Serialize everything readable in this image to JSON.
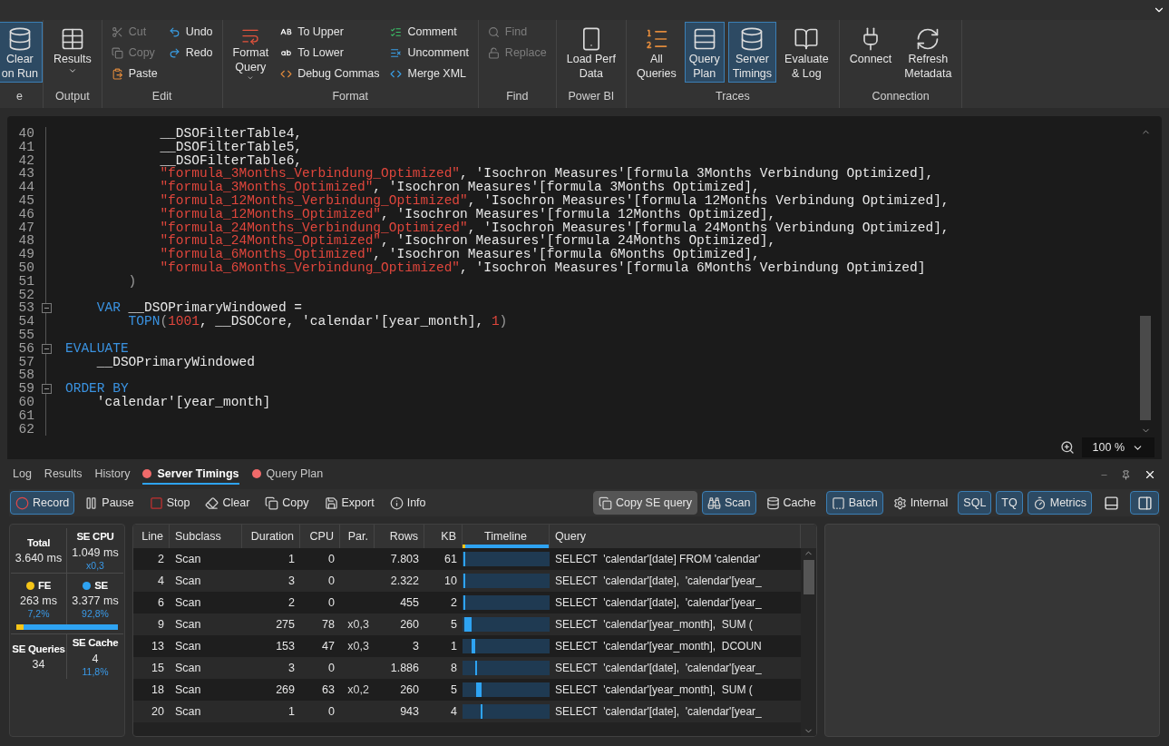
{
  "ribbon": {
    "groups": [
      {
        "label": "e",
        "columns": [
          {
            "kind": "large",
            "items": [
              {
                "lines": [
                  "Clear",
                  "on Run"
                ],
                "checked": true,
                "menu": false
              }
            ]
          }
        ]
      },
      {
        "label": "Output",
        "columns": [
          {
            "kind": "large",
            "items": [
              {
                "lines": [
                  "Results"
                ],
                "checked": false,
                "menu": true
              }
            ]
          }
        ]
      },
      {
        "label": "Edit",
        "columns": [
          {
            "kind": "stack",
            "items": [
              {
                "label": "Cut",
                "disabled": true
              },
              {
                "label": "Copy",
                "disabled": true
              },
              {
                "label": "Paste",
                "disabled": false
              }
            ]
          },
          {
            "kind": "stack",
            "items": [
              {
                "label": "Undo",
                "disabled": false
              },
              {
                "label": "Redo",
                "disabled": false
              }
            ]
          }
        ]
      },
      {
        "label": "Format",
        "columns": [
          {
            "kind": "large",
            "items": [
              {
                "lines": [
                  "Format",
                  "Query"
                ],
                "checked": false,
                "menu": true
              }
            ]
          },
          {
            "kind": "stack",
            "items": [
              {
                "label": "To Upper",
                "disabled": false
              },
              {
                "label": "To Lower",
                "disabled": false
              },
              {
                "label": "Debug Commas",
                "disabled": false
              }
            ]
          },
          {
            "kind": "stack",
            "items": [
              {
                "label": "Comment",
                "disabled": false
              },
              {
                "label": "Uncomment",
                "disabled": false
              },
              {
                "label": "Merge XML",
                "disabled": false
              }
            ]
          }
        ]
      },
      {
        "label": "Find",
        "columns": [
          {
            "kind": "stack",
            "items": [
              {
                "label": "Find",
                "disabled": true
              },
              {
                "label": "Replace",
                "disabled": true
              }
            ]
          }
        ]
      },
      {
        "label": "Power BI",
        "columns": [
          {
            "kind": "large",
            "items": [
              {
                "lines": [
                  "Load Perf",
                  "Data"
                ],
                "checked": false,
                "menu": false
              }
            ]
          }
        ]
      },
      {
        "label": "Traces",
        "columns": [
          {
            "kind": "large",
            "items": [
              {
                "lines": [
                  "All",
                  "Queries"
                ],
                "checked": false,
                "menu": false
              },
              {
                "lines": [
                  "Query",
                  "Plan"
                ],
                "checked": true,
                "menu": false
              },
              {
                "lines": [
                  "Server",
                  "Timings"
                ],
                "checked": true,
                "menu": false
              },
              {
                "lines": [
                  "Evaluate",
                  "& Log"
                ],
                "checked": false,
                "menu": false
              }
            ]
          }
        ]
      },
      {
        "label": "Connection",
        "columns": [
          {
            "kind": "large",
            "items": [
              {
                "lines": [
                  "Connect"
                ],
                "checked": false,
                "menu": false
              },
              {
                "lines": [
                  "Refresh",
                  "Metadata"
                ],
                "checked": false,
                "menu": false
              }
            ]
          }
        ]
      }
    ]
  },
  "editor": {
    "lines": [
      {
        "number": "40",
        "segments": [
          {
            "kind": "plain",
            "text": "            __DSOFilterTable4,"
          }
        ]
      },
      {
        "number": "41",
        "segments": [
          {
            "kind": "plain",
            "text": "            __DSOFilterTable5,"
          }
        ]
      },
      {
        "number": "42",
        "segments": [
          {
            "kind": "plain",
            "text": "            __DSOFilterTable6,"
          }
        ]
      },
      {
        "number": "43",
        "segments": [
          {
            "kind": "string",
            "text": "            \"formula_3Months_Verbindung_Optimized\""
          },
          {
            "kind": "plain",
            "text": ", 'Isochron Measures'[formula 3Months Verbindung Optimized],"
          }
        ]
      },
      {
        "number": "44",
        "segments": [
          {
            "kind": "string",
            "text": "            \"formula_3Months_Optimized\""
          },
          {
            "kind": "plain",
            "text": ", 'Isochron Measures'[formula 3Months Optimized],"
          }
        ]
      },
      {
        "number": "45",
        "segments": [
          {
            "kind": "string",
            "text": "            \"formula_12Months_Verbindung_Optimized\""
          },
          {
            "kind": "plain",
            "text": ", 'Isochron Measures'[formula 12Months Verbindung Optimized],"
          }
        ]
      },
      {
        "number": "46",
        "segments": [
          {
            "kind": "string",
            "text": "            \"formula_12Months_Optimized\""
          },
          {
            "kind": "plain",
            "text": ", 'Isochron Measures'[formula 12Months Optimized],"
          }
        ]
      },
      {
        "number": "47",
        "segments": [
          {
            "kind": "string",
            "text": "            \"formula_24Months_Verbindung_Optimized\""
          },
          {
            "kind": "plain",
            "text": ", 'Isochron Measures'[formula 24Months Verbindung Optimized],"
          }
        ]
      },
      {
        "number": "48",
        "segments": [
          {
            "kind": "string",
            "text": "            \"formula_24Months_Optimized\""
          },
          {
            "kind": "plain",
            "text": ", 'Isochron Measures'[formula 24Months Optimized],"
          }
        ]
      },
      {
        "number": "49",
        "segments": [
          {
            "kind": "string",
            "text": "            \"formula_6Months_Optimized\""
          },
          {
            "kind": "plain",
            "text": ", 'Isochron Measures'[formula 6Months Optimized],"
          }
        ]
      },
      {
        "number": "50",
        "segments": [
          {
            "kind": "string",
            "text": "            \"formula_6Months_Verbindung_Optimized\""
          },
          {
            "kind": "plain",
            "text": ", 'Isochron Measures'[formula 6Months Verbindung Optimized]"
          }
        ]
      },
      {
        "number": "51",
        "segments": [
          {
            "kind": "paren",
            "text": "        )"
          }
        ]
      },
      {
        "number": "52"
      },
      {
        "number": "53",
        "expanded": true,
        "segments": [
          {
            "kind": "keyword",
            "text": "    VAR"
          },
          {
            "kind": "plain",
            "text": " __DSOPrimaryWindowed ="
          }
        ]
      },
      {
        "number": "54",
        "segments": [
          {
            "kind": "keyword",
            "text": "        TOPN"
          },
          {
            "kind": "paren",
            "text": "("
          },
          {
            "kind": "number",
            "text": "1001"
          },
          {
            "kind": "plain",
            "text": ", __DSOCore, 'calendar'[year_month], "
          },
          {
            "kind": "number",
            "text": "1"
          },
          {
            "kind": "paren",
            "text": ")"
          }
        ]
      },
      {
        "number": "55"
      },
      {
        "number": "56",
        "expanded": true,
        "segments": [
          {
            "kind": "keyword",
            "text": "EVALUATE"
          }
        ]
      },
      {
        "number": "57",
        "segments": [
          {
            "kind": "plain",
            "text": "    __DSOPrimaryWindowed"
          }
        ]
      },
      {
        "number": "58"
      },
      {
        "number": "59",
        "expanded": true,
        "segments": [
          {
            "kind": "keyword",
            "text": "ORDER BY"
          }
        ]
      },
      {
        "number": "60",
        "segments": [
          {
            "kind": "plain",
            "text": "    'calendar'[year_month]"
          }
        ]
      },
      {
        "number": "61"
      },
      {
        "number": "62"
      }
    ],
    "zoom": "100 %"
  },
  "panel": {
    "tabs": [
      {
        "label": "Log",
        "selected": false,
        "recording": false
      },
      {
        "label": "Results",
        "selected": false,
        "recording": false
      },
      {
        "label": "History",
        "selected": false,
        "recording": false
      },
      {
        "label": "Server Timings",
        "selected": true,
        "recording": true
      },
      {
        "label": "Query Plan",
        "selected": false,
        "recording": true
      }
    ],
    "toolbar_left": [
      {
        "label": "Record",
        "on": true
      },
      {
        "label": "Pause",
        "on": false
      },
      {
        "label": "Stop",
        "on": false
      },
      {
        "label": "Clear",
        "on": false
      },
      {
        "label": "Copy",
        "on": false
      },
      {
        "label": "Export",
        "on": false
      },
      {
        "label": "Info",
        "on": false
      }
    ],
    "toolbar_right": [
      {
        "kind": "shaded",
        "label": "Copy SE query"
      },
      {
        "kind": "text",
        "label": "Scan",
        "on": true
      },
      {
        "kind": "text",
        "label": "Cache",
        "on": false
      },
      {
        "kind": "text",
        "label": "Batch",
        "on": true
      },
      {
        "kind": "text",
        "label": "Internal",
        "on": false
      },
      {
        "kind": "text",
        "label": "SQL",
        "on": true
      },
      {
        "kind": "text",
        "label": "TQ",
        "on": true
      },
      {
        "kind": "text",
        "label": "Metrics",
        "on": true
      },
      {
        "kind": "layout",
        "on": false
      },
      {
        "kind": "layout",
        "on": true
      }
    ],
    "stats": {
      "total": {
        "label": "Total",
        "value": "3.640 ms"
      },
      "se_cpu": {
        "label": "SE CPU",
        "value": "1.049 ms",
        "sub": "x0,3"
      },
      "fe": {
        "label": "FE",
        "value": "263 ms",
        "sub": "7,2%",
        "color": "#f5c518"
      },
      "se": {
        "label": "SE",
        "value": "3.377 ms",
        "sub": "92,8%",
        "color": "#2ea3f2"
      },
      "fe_share": {
        "level": 0.072
      },
      "se_queries": {
        "label": "SE Queries",
        "value": "34"
      },
      "se_cache": {
        "label": "SE Cache",
        "value": "4",
        "sub": "11,8%"
      }
    },
    "table": {
      "columns": [
        "Line",
        "Subclass",
        "Duration",
        "CPU",
        "Par.",
        "Rows",
        "KB",
        "Timeline",
        "Query"
      ],
      "rows": [
        {
          "line": "2",
          "subclass": "Scan",
          "duration": "1",
          "cpu": "0",
          "rows": "7.803",
          "kb": "61",
          "query": "SELECT  'calendar'[date] FROM 'calendar'"
        },
        {
          "line": "4",
          "subclass": "Scan",
          "duration": "3",
          "cpu": "0",
          "rows": "2.322",
          "kb": "10",
          "query": "SELECT  'calendar'[date],  'calendar'[year_"
        },
        {
          "line": "6",
          "subclass": "Scan",
          "duration": "2",
          "cpu": "0",
          "rows": "455",
          "kb": "2",
          "query": "SELECT  'calendar'[date],  'calendar'[year_"
        },
        {
          "line": "9",
          "subclass": "Scan",
          "duration": "275",
          "cpu": "78",
          "par": "x0,3",
          "rows": "260",
          "kb": "5",
          "query": "SELECT  'calendar'[year_month],  SUM ("
        },
        {
          "line": "13",
          "subclass": "Scan",
          "duration": "153",
          "cpu": "47",
          "par": "x0,3",
          "rows": "3",
          "kb": "1",
          "query": "SELECT  'calendar'[year_month],  DCOUN"
        },
        {
          "line": "15",
          "subclass": "Scan",
          "duration": "3",
          "cpu": "0",
          "rows": "1.886",
          "kb": "8",
          "query": "SELECT  'calendar'[date],  'calendar'[year_"
        },
        {
          "line": "18",
          "subclass": "Scan",
          "duration": "269",
          "cpu": "63",
          "par": "x0,2",
          "rows": "260",
          "kb": "5",
          "query": "SELECT  'calendar'[year_month],  SUM ("
        },
        {
          "line": "20",
          "subclass": "Scan",
          "duration": "1",
          "cpu": "0",
          "rows": "943",
          "kb": "4",
          "query": "SELECT  'calendar'[date],  'calendar'[year_"
        }
      ]
    }
  }
}
